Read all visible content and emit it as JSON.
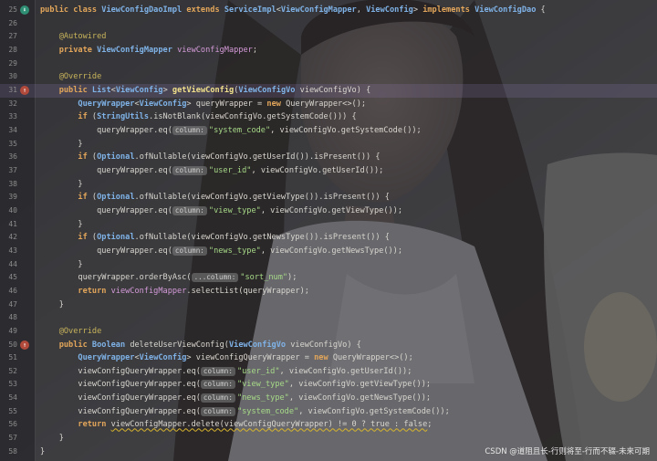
{
  "editor": {
    "lines": [
      {
        "n": "25",
        "marker": "impl",
        "tokens": [
          [
            "kw",
            "public class "
          ],
          [
            "ty",
            "ViewConfigDaoImpl "
          ],
          [
            "kw",
            "extends "
          ],
          [
            "ty",
            "ServiceImpl"
          ],
          [
            "",
            "<"
          ],
          [
            "ty",
            "ViewConfigMapper"
          ],
          [
            "",
            ", "
          ],
          [
            "ty",
            "ViewConfig"
          ],
          [
            "",
            "> "
          ],
          [
            "kw",
            "implements "
          ],
          [
            "ty",
            "ViewConfigDao"
          ],
          [
            "",
            " {"
          ]
        ]
      },
      {
        "n": "26",
        "tokens": []
      },
      {
        "n": "27",
        "tokens": [
          [
            "ann",
            "    @Autowired"
          ]
        ]
      },
      {
        "n": "28",
        "tokens": [
          [
            "kw",
            "    private "
          ],
          [
            "ty",
            "ViewConfigMapper "
          ],
          [
            "fld",
            "viewConfigMapper"
          ],
          [
            "",
            ";"
          ]
        ]
      },
      {
        "n": "29",
        "tokens": []
      },
      {
        "n": "30",
        "tokens": [
          [
            "ann",
            "    @Override"
          ]
        ]
      },
      {
        "n": "31",
        "marker": "ov",
        "highlight": true,
        "tokens": [
          [
            "kw",
            "    public "
          ],
          [
            "ty",
            "List"
          ],
          [
            "",
            "<"
          ],
          [
            "ty",
            "ViewConfig"
          ],
          [
            "",
            "> "
          ],
          [
            "mth",
            "getViewConfig"
          ],
          [
            "",
            "("
          ],
          [
            "ty",
            "ViewConfigVo "
          ],
          [
            "",
            "viewConfigVo) {"
          ]
        ]
      },
      {
        "n": "32",
        "tokens": [
          [
            "ty",
            "        QueryWrapper"
          ],
          [
            "",
            "<"
          ],
          [
            "ty",
            "ViewConfig"
          ],
          [
            "",
            "> queryWrapper = "
          ],
          [
            "kw",
            "new "
          ],
          [
            "",
            "QueryWrapper<>();"
          ]
        ]
      },
      {
        "n": "33",
        "tokens": [
          [
            "kw",
            "        if "
          ],
          [
            "",
            "("
          ],
          [
            "ty",
            "StringUtils"
          ],
          [
            "",
            ".isNotBlank(viewConfigVo.getSystemCode())) {"
          ]
        ]
      },
      {
        "n": "34",
        "tokens": [
          [
            "",
            "            queryWrapper.eq("
          ],
          [
            "hint",
            "column:"
          ],
          [
            "st",
            "\"system_code\""
          ],
          [
            "",
            ", viewConfigVo.getSystemCode());"
          ]
        ]
      },
      {
        "n": "35",
        "tokens": [
          [
            "",
            "        }"
          ]
        ]
      },
      {
        "n": "36",
        "tokens": [
          [
            "kw",
            "        if "
          ],
          [
            "",
            "("
          ],
          [
            "ty",
            "Optional"
          ],
          [
            "",
            ".ofNullable(viewConfigVo.getUserId()).isPresent()) {"
          ]
        ]
      },
      {
        "n": "37",
        "tokens": [
          [
            "",
            "            queryWrapper.eq("
          ],
          [
            "hint",
            "column:"
          ],
          [
            "st",
            "\"user_id\""
          ],
          [
            "",
            ", viewConfigVo.getUserId());"
          ]
        ]
      },
      {
        "n": "38",
        "tokens": [
          [
            "",
            "        }"
          ]
        ]
      },
      {
        "n": "39",
        "tokens": [
          [
            "kw",
            "        if "
          ],
          [
            "",
            "("
          ],
          [
            "ty",
            "Optional"
          ],
          [
            "",
            ".ofNullable(viewConfigVo.getViewType()).isPresent()) {"
          ]
        ]
      },
      {
        "n": "40",
        "tokens": [
          [
            "",
            "            queryWrapper.eq("
          ],
          [
            "hint",
            "column:"
          ],
          [
            "st",
            "\"view_type\""
          ],
          [
            "",
            ", viewConfigVo.getViewType());"
          ]
        ]
      },
      {
        "n": "41",
        "tokens": [
          [
            "",
            "        }"
          ]
        ]
      },
      {
        "n": "42",
        "tokens": [
          [
            "kw",
            "        if "
          ],
          [
            "",
            "("
          ],
          [
            "ty",
            "Optional"
          ],
          [
            "",
            ".ofNullable(viewConfigVo.getNewsType()).isPresent()) {"
          ]
        ]
      },
      {
        "n": "43",
        "tokens": [
          [
            "",
            "            queryWrapper.eq("
          ],
          [
            "hint",
            "column:"
          ],
          [
            "st",
            "\"news_type\""
          ],
          [
            "",
            ", viewConfigVo.getNewsType());"
          ]
        ]
      },
      {
        "n": "44",
        "tokens": [
          [
            "",
            "        }"
          ]
        ]
      },
      {
        "n": "45",
        "tokens": [
          [
            "",
            "        queryWrapper.orderByAsc("
          ],
          [
            "hint",
            "...column:"
          ],
          [
            "st",
            "\"sort_num\""
          ],
          [
            "",
            ");"
          ]
        ]
      },
      {
        "n": "46",
        "tokens": [
          [
            "kw",
            "        return "
          ],
          [
            "fld",
            "viewConfigMapper"
          ],
          [
            "",
            ".selectList(queryWrapper);"
          ]
        ]
      },
      {
        "n": "47",
        "tokens": [
          [
            "",
            "    }"
          ]
        ]
      },
      {
        "n": "48",
        "tokens": []
      },
      {
        "n": "49",
        "tokens": [
          [
            "ann",
            "    @Override"
          ]
        ]
      },
      {
        "n": "50",
        "marker": "ov",
        "tokens": [
          [
            "kw",
            "    public "
          ],
          [
            "ty",
            "Boolean "
          ],
          [
            "",
            "deleteUserViewConfig("
          ],
          [
            "ty",
            "ViewConfigVo "
          ],
          [
            "",
            "viewConfigVo) {"
          ]
        ]
      },
      {
        "n": "51",
        "tokens": [
          [
            "ty",
            "        QueryWrapper"
          ],
          [
            "",
            "<"
          ],
          [
            "ty",
            "ViewConfig"
          ],
          [
            "",
            "> viewConfigQueryWrapper = "
          ],
          [
            "kw",
            "new "
          ],
          [
            "",
            "QueryWrapper<>();"
          ]
        ]
      },
      {
        "n": "52",
        "tokens": [
          [
            "",
            "        viewConfigQueryWrapper.eq("
          ],
          [
            "hint",
            "column:"
          ],
          [
            "st",
            "\"user_id\""
          ],
          [
            "",
            ", viewConfigVo.getUserId());"
          ]
        ]
      },
      {
        "n": "53",
        "tokens": [
          [
            "",
            "        viewConfigQueryWrapper.eq("
          ],
          [
            "hint",
            "column:"
          ],
          [
            "st",
            "\"view_type\""
          ],
          [
            "",
            ", viewConfigVo.getViewType());"
          ]
        ]
      },
      {
        "n": "54",
        "tokens": [
          [
            "",
            "        viewConfigQueryWrapper.eq("
          ],
          [
            "hint",
            "column:"
          ],
          [
            "st",
            "\"news_type\""
          ],
          [
            "",
            ", viewConfigVo.getNewsType());"
          ]
        ]
      },
      {
        "n": "55",
        "tokens": [
          [
            "",
            "        viewConfigQueryWrapper.eq("
          ],
          [
            "hint",
            "column:"
          ],
          [
            "st",
            "\"system_code\""
          ],
          [
            "",
            ", viewConfigVo.getSystemCode());"
          ]
        ]
      },
      {
        "n": "56",
        "tokens": [
          [
            "kw",
            "        return "
          ],
          [
            "warn",
            "viewConfigMapper.delete(viewConfigQueryWrapper) != 0 ? true : false"
          ],
          [
            "",
            ";"
          ]
        ]
      },
      {
        "n": "57",
        "tokens": [
          [
            "",
            "    }"
          ]
        ]
      },
      {
        "n": "58",
        "tokens": [
          [
            "",
            "}"
          ]
        ]
      }
    ]
  },
  "watermark": "CSDN @道阻且长-行则将至-行而不辍-未来可期",
  "colors": {
    "keyword": "#e3a65a",
    "type": "#7fb3e8",
    "string": "#a6d987",
    "annotation": "#c8b45a"
  }
}
